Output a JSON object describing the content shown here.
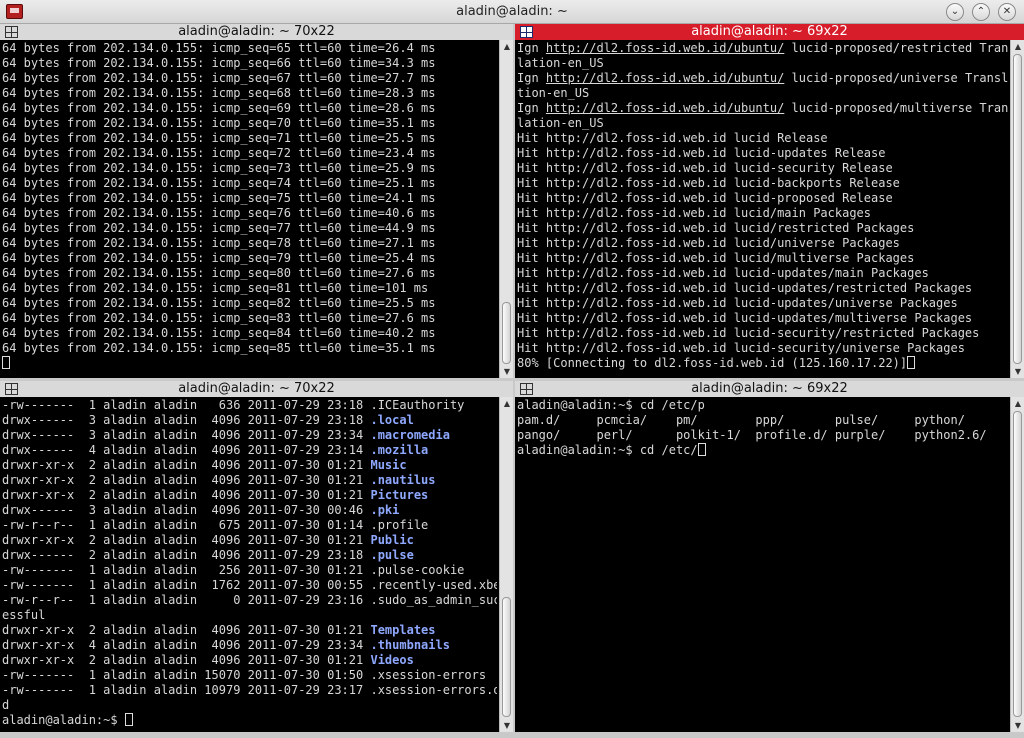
{
  "window": {
    "title": "aladin@aladin: ~",
    "minimize": "⌄",
    "maximize": "⌃",
    "close": "✕"
  },
  "panes": {
    "top_left": {
      "title": "aladin@aladin: ~ 70x22",
      "lines": [
        "64 bytes from 202.134.0.155: icmp_seq=65 ttl=60 time=26.4 ms",
        "64 bytes from 202.134.0.155: icmp_seq=66 ttl=60 time=34.3 ms",
        "64 bytes from 202.134.0.155: icmp_seq=67 ttl=60 time=27.7 ms",
        "64 bytes from 202.134.0.155: icmp_seq=68 ttl=60 time=28.3 ms",
        "64 bytes from 202.134.0.155: icmp_seq=69 ttl=60 time=28.6 ms",
        "64 bytes from 202.134.0.155: icmp_seq=70 ttl=60 time=35.1 ms",
        "64 bytes from 202.134.0.155: icmp_seq=71 ttl=60 time=25.5 ms",
        "64 bytes from 202.134.0.155: icmp_seq=72 ttl=60 time=23.4 ms",
        "64 bytes from 202.134.0.155: icmp_seq=73 ttl=60 time=25.9 ms",
        "64 bytes from 202.134.0.155: icmp_seq=74 ttl=60 time=25.1 ms",
        "64 bytes from 202.134.0.155: icmp_seq=75 ttl=60 time=24.1 ms",
        "64 bytes from 202.134.0.155: icmp_seq=76 ttl=60 time=40.6 ms",
        "64 bytes from 202.134.0.155: icmp_seq=77 ttl=60 time=44.9 ms",
        "64 bytes from 202.134.0.155: icmp_seq=78 ttl=60 time=27.1 ms",
        "64 bytes from 202.134.0.155: icmp_seq=79 ttl=60 time=25.4 ms",
        "64 bytes from 202.134.0.155: icmp_seq=80 ttl=60 time=27.6 ms",
        "64 bytes from 202.134.0.155: icmp_seq=81 ttl=60 time=101 ms",
        "64 bytes from 202.134.0.155: icmp_seq=82 ttl=60 time=25.5 ms",
        "64 bytes from 202.134.0.155: icmp_seq=83 ttl=60 time=27.6 ms",
        "64 bytes from 202.134.0.155: icmp_seq=84 ttl=60 time=40.2 ms",
        "64 bytes from 202.134.0.155: icmp_seq=85 ttl=60 time=35.1 ms"
      ]
    },
    "top_right": {
      "title": "aladin@aladin: ~ 69x22",
      "ign_lines": [
        {
          "prefix": "Ign ",
          "url": "http://dl2.foss-id.web.id/ubuntu/",
          "rest": " lucid-proposed/restricted Trans",
          "wrap": "lation-en_US"
        },
        {
          "prefix": "Ign ",
          "url": "http://dl2.foss-id.web.id/ubuntu/",
          "rest": " lucid-proposed/universe Transla",
          "wrap": "tion-en_US"
        },
        {
          "prefix": "Ign ",
          "url": "http://dl2.foss-id.web.id/ubuntu/",
          "rest": " lucid-proposed/multiverse Trans",
          "wrap": "lation-en_US"
        }
      ],
      "hit_lines": [
        "Hit http://dl2.foss-id.web.id lucid Release",
        "Hit http://dl2.foss-id.web.id lucid-updates Release",
        "Hit http://dl2.foss-id.web.id lucid-security Release",
        "Hit http://dl2.foss-id.web.id lucid-backports Release",
        "Hit http://dl2.foss-id.web.id lucid-proposed Release",
        "Hit http://dl2.foss-id.web.id lucid/main Packages",
        "Hit http://dl2.foss-id.web.id lucid/restricted Packages",
        "Hit http://dl2.foss-id.web.id lucid/universe Packages",
        "Hit http://dl2.foss-id.web.id lucid/multiverse Packages",
        "Hit http://dl2.foss-id.web.id lucid-updates/main Packages",
        "Hit http://dl2.foss-id.web.id lucid-updates/restricted Packages",
        "Hit http://dl2.foss-id.web.id lucid-updates/universe Packages",
        "Hit http://dl2.foss-id.web.id lucid-updates/multiverse Packages",
        "Hit http://dl2.foss-id.web.id lucid-security/restricted Packages",
        "Hit http://dl2.foss-id.web.id lucid-security/universe Packages"
      ],
      "progress_line": "80% [Connecting to dl2.foss-id.web.id (125.160.17.22)]"
    },
    "bottom_left": {
      "title": "aladin@aladin: ~ 70x22",
      "rows": [
        {
          "meta": "-rw-------  1 aladin aladin   636 2011-07-29 23:18 ",
          "name": ".ICEauthority",
          "dir": false
        },
        {
          "meta": "drwx------  3 aladin aladin  4096 2011-07-29 23:18 ",
          "name": ".local",
          "dir": true
        },
        {
          "meta": "drwx------  3 aladin aladin  4096 2011-07-29 23:34 ",
          "name": ".macromedia",
          "dir": true
        },
        {
          "meta": "drwx------  4 aladin aladin  4096 2011-07-29 23:14 ",
          "name": ".mozilla",
          "dir": true
        },
        {
          "meta": "drwxr-xr-x  2 aladin aladin  4096 2011-07-30 01:21 ",
          "name": "Music",
          "dir": true
        },
        {
          "meta": "drwxr-xr-x  2 aladin aladin  4096 2011-07-30 01:21 ",
          "name": ".nautilus",
          "dir": true
        },
        {
          "meta": "drwxr-xr-x  2 aladin aladin  4096 2011-07-30 01:21 ",
          "name": "Pictures",
          "dir": true
        },
        {
          "meta": "drwx------  3 aladin aladin  4096 2011-07-30 00:46 ",
          "name": ".pki",
          "dir": true
        },
        {
          "meta": "-rw-r--r--  1 aladin aladin   675 2011-07-30 01:14 ",
          "name": ".profile",
          "dir": false
        },
        {
          "meta": "drwxr-xr-x  2 aladin aladin  4096 2011-07-30 01:21 ",
          "name": "Public",
          "dir": true
        },
        {
          "meta": "drwx------  2 aladin aladin  4096 2011-07-29 23:18 ",
          "name": ".pulse",
          "dir": true
        },
        {
          "meta": "-rw-------  1 aladin aladin   256 2011-07-30 01:21 ",
          "name": ".pulse-cookie",
          "dir": false
        },
        {
          "meta": "-rw-------  1 aladin aladin  1762 2011-07-30 00:55 ",
          "name": ".recently-used.xbel",
          "dir": false
        },
        {
          "meta": "-rw-r--r--  1 aladin aladin     0 2011-07-29 23:16 ",
          "name": ".sudo_as_admin_succ",
          "dir": false
        },
        {
          "meta": "",
          "name": "essful",
          "dir": false
        },
        {
          "meta": "drwxr-xr-x  2 aladin aladin  4096 2011-07-30 01:21 ",
          "name": "Templates",
          "dir": true
        },
        {
          "meta": "drwxr-xr-x  4 aladin aladin  4096 2011-07-29 23:34 ",
          "name": ".thumbnails",
          "dir": true
        },
        {
          "meta": "drwxr-xr-x  2 aladin aladin  4096 2011-07-30 01:21 ",
          "name": "Videos",
          "dir": true
        },
        {
          "meta": "-rw-------  1 aladin aladin 15070 2011-07-30 01:50 ",
          "name": ".xsession-errors",
          "dir": false
        },
        {
          "meta": "-rw-------  1 aladin aladin 10979 2011-07-29 23:17 ",
          "name": ".xsession-errors.ol",
          "dir": false
        },
        {
          "meta": "",
          "name": "d",
          "dir": false
        }
      ],
      "prompt": "aladin@aladin:~$ "
    },
    "bottom_right": {
      "title": "aladin@aladin: ~ 69x22",
      "lines": [
        "aladin@aladin:~$ cd /etc/p",
        "pam.d/     pcmcia/    pm/        ppp/       pulse/     python/",
        "pango/     perl/      polkit-1/  profile.d/ purple/    python2.6/"
      ],
      "prompt": "aladin@aladin:~$ cd /etc/"
    }
  },
  "colors": {
    "active_header": "#d71d2a",
    "directory": "#8fa8ff",
    "terminal_bg": "#000000",
    "terminal_fg": "#d8d8d8"
  }
}
